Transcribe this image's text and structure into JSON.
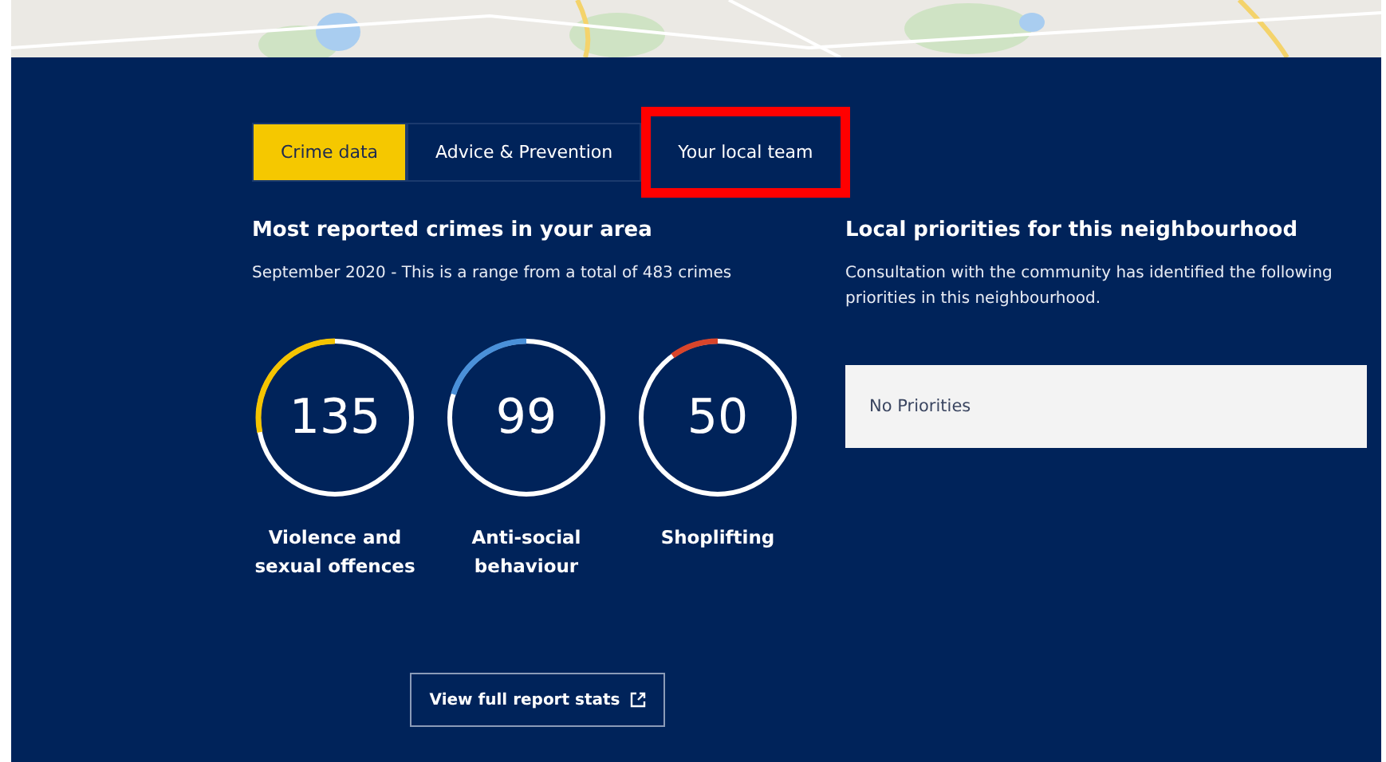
{
  "tabs": [
    {
      "label": "Crime data",
      "selected": true,
      "highlighted": false
    },
    {
      "label": "Advice & Prevention",
      "selected": false,
      "highlighted": false
    },
    {
      "label": "Your local team",
      "selected": false,
      "highlighted": true
    }
  ],
  "crimes": {
    "heading": "Most reported crimes in your area",
    "subtitle": "September 2020 - This is a range from a total of 483 crimes",
    "items": [
      {
        "count": "135",
        "label": "Violence and sexual offences",
        "level": 0.28,
        "color": "#f5c400"
      },
      {
        "count": "99",
        "label": "Anti-social behaviour",
        "level": 0.2,
        "color": "#4a90d9"
      },
      {
        "count": "50",
        "label": "Shoplifting",
        "level": 0.1,
        "color": "#d9452b"
      }
    ]
  },
  "priorities": {
    "heading": "Local priorities for this neighbourhood",
    "text": "Consultation with the community has identified the following priorities in this neighbourhood.",
    "box": "No Priorities"
  },
  "report_button": {
    "label": "View full report stats"
  }
}
